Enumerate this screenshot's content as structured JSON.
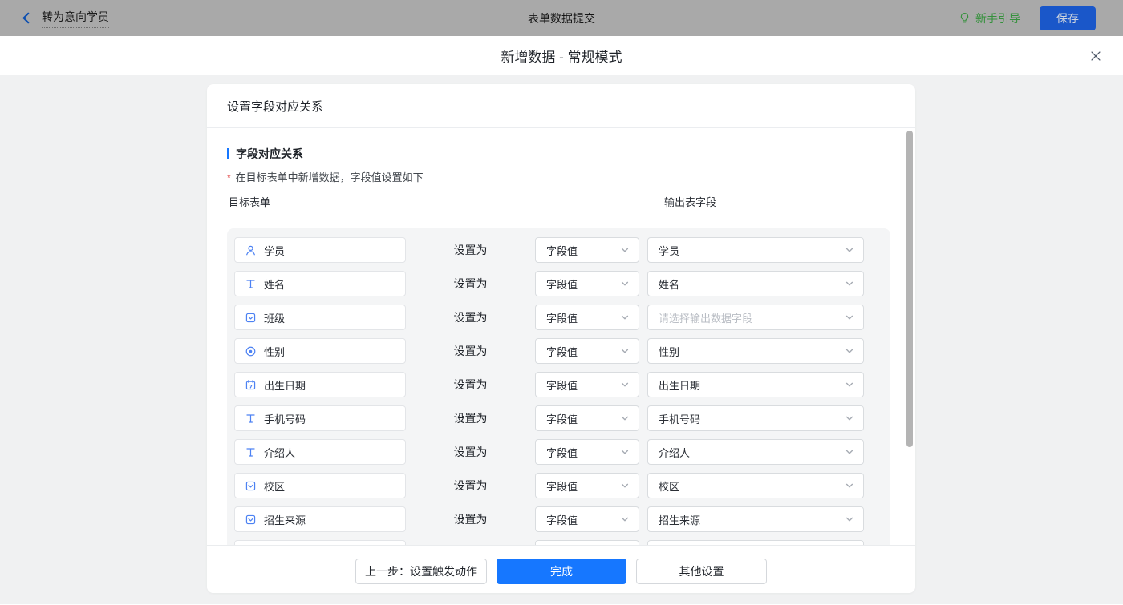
{
  "topbar": {
    "back_label": "转为意向学员",
    "title": "表单数据提交",
    "guide_label": "新手引导",
    "save_label": "保存"
  },
  "modal": {
    "title": "新增数据 - 常规模式"
  },
  "card": {
    "header": "设置字段对应关系",
    "section_title": "字段对应关系",
    "note_mark": "*",
    "note": "在目标表单中新增数据，字段值设置如下",
    "col_left": "目标表单",
    "col_right": "输出表字段"
  },
  "mappings": {
    "set_as_label": "设置为",
    "rows": [
      {
        "field": "学员",
        "icon": "user-field-icon",
        "value_type": "字段值",
        "output": "学员"
      },
      {
        "field": "姓名",
        "icon": "text-field-icon",
        "value_type": "字段值",
        "output": "姓名"
      },
      {
        "field": "班级",
        "icon": "select-field-icon",
        "value_type": "字段值",
        "output": "请选择输出数据字段",
        "output_placeholder": true
      },
      {
        "field": "性别",
        "icon": "radio-field-icon",
        "value_type": "字段值",
        "output": "性别"
      },
      {
        "field": "出生日期",
        "icon": "date-field-icon",
        "value_type": "字段值",
        "output": "出生日期"
      },
      {
        "field": "手机号码",
        "icon": "text-field-icon",
        "value_type": "字段值",
        "output": "手机号码"
      },
      {
        "field": "介绍人",
        "icon": "text-field-icon",
        "value_type": "字段值",
        "output": "介绍人"
      },
      {
        "field": "校区",
        "icon": "select-field-icon",
        "value_type": "字段值",
        "output": "校区"
      },
      {
        "field": "招生来源",
        "icon": "select-field-icon",
        "value_type": "字段值",
        "output": "招生来源"
      },
      {
        "field": "",
        "icon": "",
        "value_type": "",
        "output": "",
        "partial": true
      }
    ]
  },
  "footer": {
    "prev_label": "上一步：设置触发动作",
    "done_label": "完成",
    "other_label": "其他设置"
  },
  "colors": {
    "primary_blue": "#1677ff",
    "field_icon_blue": "#4d82f3",
    "guide_green": "#35913c",
    "dim_topbar_gray": "#a9a9a9",
    "placeholder_gray": "#b9bdc4"
  }
}
